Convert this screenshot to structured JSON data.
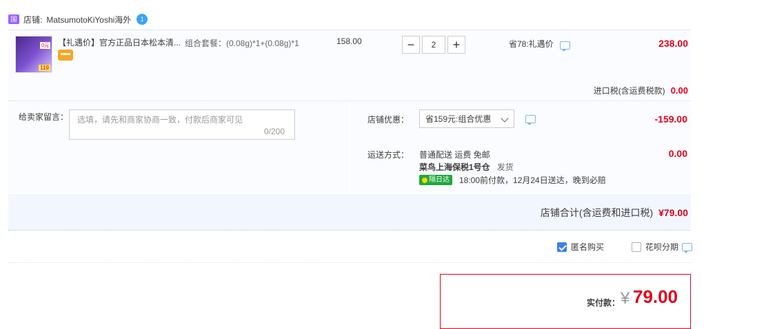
{
  "shop": {
    "label": "店铺:",
    "name": "MatsumotoKiYoshi海外",
    "icon": "tmall-global-icon",
    "im_badge": "1"
  },
  "item": {
    "thumb_badge": "119",
    "thumb_tag": "0元",
    "title": "【礼遇价】官方正品日本松本清...",
    "sku": "组合套餐：(0.08g)*1+(0.08g)*1",
    "price": "158.00",
    "quantity": "2",
    "save_text": "省78:礼遇价",
    "subtotal": "238.00"
  },
  "import_tax": {
    "label": "进口税(含运费税款)",
    "value": "0.00"
  },
  "message": {
    "label": "给卖家留言：",
    "placeholder": "选填，请先和商家协商一致，付款后商家可见",
    "count": "0/200"
  },
  "promo": {
    "label": "店铺优惠：",
    "selected": "省159元:组合优惠",
    "value": "-159.00"
  },
  "shipping": {
    "label": "运送方式：",
    "line1": "普通配送 运费 免邮",
    "warehouse": "菜鸟上海保税1号仓",
    "dispatch": "发货",
    "badge": "隔日达",
    "eta": "18:00前付款，12月24日送达，晚到必赔",
    "value": "0.00"
  },
  "total": {
    "label": "店铺合计(含运费和进口税)",
    "value": "¥79.00"
  },
  "options": {
    "anonymous": "匿名购买",
    "anonymous_checked": true,
    "huabei": "花呗分期",
    "huabei_checked": false
  },
  "payment": {
    "label": "实付款：",
    "symbol": "¥",
    "value": "79.00"
  },
  "colors": {
    "accent": "#e0001b",
    "link": "#3e7ef0"
  }
}
